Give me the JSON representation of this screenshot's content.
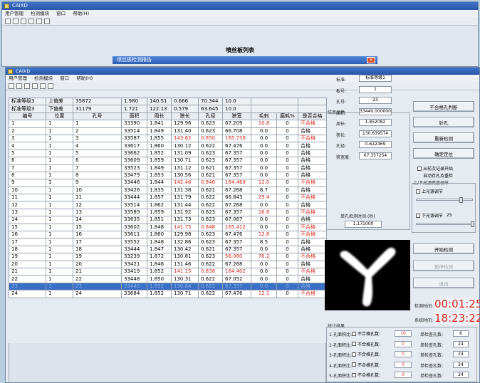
{
  "bg_window": {
    "title": "CAIXD",
    "menu": [
      "用户管理",
      "检测模块",
      "窗口",
      "帮助(H)"
    ],
    "heading": "喷丝板列表"
  },
  "modal": {
    "title": "喷丝板检测报告",
    "close": "×"
  },
  "main_window": {
    "title": "CAIXD",
    "menu": [
      "用户管理",
      "检测模块",
      "窗口",
      "帮助(H)"
    ]
  },
  "table": {
    "std_rows": [
      [
        "标准等级3",
        "上偏差",
        "35872",
        "1.980",
        "140.51",
        "0.666",
        "70.344",
        "10.0",
        "",
        ""
      ],
      [
        "标准等级3",
        "下偏差",
        "31179",
        "1.721",
        "122.13",
        "0.579",
        "63.645",
        "10.0",
        "",
        ""
      ]
    ],
    "headers": [
      "编号",
      "位置",
      "孔号",
      "面积",
      "周长",
      "狭长",
      "孔径",
      "狭宽",
      "毛刺",
      "磨耗%",
      "是否合格"
    ],
    "rows": [
      [
        "1",
        "1",
        "1",
        "33390",
        "1.841",
        "129.96",
        "0.623",
        "67.209",
        "10.8",
        "0",
        "不合格"
      ],
      [
        "2",
        "1",
        "2",
        "33514",
        "1.849",
        "131.40",
        "0.623",
        "66.708",
        "0.0",
        "0",
        "合格"
      ],
      [
        "3",
        "1",
        "3",
        "33587",
        "1.855",
        "143.62",
        "0.850",
        "165.738",
        "0.0",
        "0",
        "不合格"
      ],
      [
        "4",
        "1",
        "4",
        "33617",
        "1.860",
        "130.12",
        "0.622",
        "67.476",
        "0.0",
        "0",
        "合格"
      ],
      [
        "5",
        "1",
        "5",
        "33662",
        "1.852",
        "131.09",
        "0.623",
        "67.357",
        "0.0",
        "0",
        "合格"
      ],
      [
        "6",
        "1",
        "6",
        "33609",
        "1.859",
        "130.71",
        "0.623",
        "67.357",
        "0.0",
        "0",
        "合格"
      ],
      [
        "7",
        "1",
        "7",
        "33523",
        "1.849",
        "131.12",
        "0.621",
        "67.357",
        "0.0",
        "0",
        "合格"
      ],
      [
        "8",
        "1",
        "8",
        "33479",
        "1.853",
        "130.56",
        "0.621",
        "67.357",
        "0.0",
        "0",
        "合格"
      ],
      [
        "9",
        "1",
        "9",
        "33448",
        "1.844",
        "142.46",
        "0.846",
        "164.469",
        "12.0",
        "0",
        "不合格"
      ],
      [
        "10",
        "1",
        "10",
        "33426",
        "1.835",
        "131.38",
        "0.621",
        "67.268",
        "8.7",
        "0",
        "合格"
      ],
      [
        "11",
        "1",
        "11",
        "33444",
        "1.857",
        "131.79",
        "0.622",
        "66.843",
        "29.4",
        "0",
        "不合格"
      ],
      [
        "12",
        "1",
        "12",
        "33514",
        "1.862",
        "131.44",
        "0.622",
        "67.268",
        "0.0",
        "0",
        "合格"
      ],
      [
        "13",
        "1",
        "13",
        "33589",
        "1.859",
        "131.92",
        "0.623",
        "67.357",
        "16.8",
        "0",
        "不合格"
      ],
      [
        "14",
        "1",
        "14",
        "33635",
        "1.851",
        "131.73",
        "0.623",
        "67.067",
        "0.0",
        "0",
        "合格"
      ],
      [
        "15",
        "1",
        "15",
        "33602",
        "1.848",
        "141.75",
        "0.848",
        "165.412",
        "0.0",
        "0",
        "不合格"
      ],
      [
        "16",
        "1",
        "16",
        "33611",
        "1.860",
        "129.98",
        "0.623",
        "67.476",
        "12.8",
        "0",
        "不合格"
      ],
      [
        "17",
        "1",
        "17",
        "33552",
        "1.848",
        "132.86",
        "0.623",
        "67.357",
        "8.5",
        "0",
        "合格"
      ],
      [
        "18",
        "1",
        "18",
        "33444",
        "1.847",
        "130.42",
        "0.621",
        "67.357",
        "0.0",
        "0",
        "合格"
      ],
      [
        "19",
        "1",
        "19",
        "33239",
        "1.872",
        "130.81",
        "0.623",
        "56.080",
        "76.2",
        "0",
        "不合格"
      ],
      [
        "20",
        "1",
        "20",
        "33421",
        "1.846",
        "131.46",
        "0.622",
        "67.268",
        "0.0",
        "0",
        "合格"
      ],
      [
        "21",
        "1",
        "21",
        "33419",
        "1.852",
        "141.15",
        "0.838",
        "164.402",
        "0.0",
        "0",
        "不合格"
      ],
      [
        "22",
        "1",
        "22",
        "33448",
        "1.850",
        "130.31",
        "0.622",
        "67.052",
        "0.0",
        "0",
        "合格"
      ],
      [
        "23",
        "1",
        "23",
        "33440",
        "1.852",
        "130.64",
        "0.621",
        "67.357",
        "0.0",
        "0",
        "合格"
      ],
      [
        "24",
        "1",
        "24",
        "33684",
        "1.852",
        "130.71",
        "0.622",
        "67.476",
        "12.1",
        "0",
        "不合格"
      ]
    ],
    "selected_row": 22,
    "red_cells": {
      "0": [
        8,
        10
      ],
      "2": [
        5,
        6,
        7,
        10
      ],
      "8": [
        5,
        6,
        7,
        8,
        10
      ],
      "10": [
        8,
        10
      ],
      "12": [
        8,
        10
      ],
      "14": [
        5,
        6,
        7,
        10
      ],
      "15": [
        8,
        10
      ],
      "18": [
        7,
        8,
        10
      ],
      "20": [
        5,
        6,
        7,
        10
      ],
      "23": [
        8,
        10
      ]
    }
  },
  "results": {
    "section": "结果显示",
    "fields": [
      {
        "label": "标准:",
        "value": "标准等级1"
      },
      {
        "label": "板号:",
        "value": "1"
      },
      {
        "label": "孔号:",
        "value": "23"
      },
      {
        "label": "面积:",
        "value": "33440.000000"
      },
      {
        "label": "周长:",
        "value": "1.852082"
      },
      {
        "label": "狭长:",
        "value": "130.639574"
      },
      {
        "label": "孔径:",
        "value": "0.622469"
      },
      {
        "label": "狭宽度:",
        "value": "67.357254"
      }
    ],
    "single_time_label": "单孔检测时间:(秒)",
    "single_time_value": "1.171000"
  },
  "buttons": {
    "unqualified": "不合格孔判断",
    "hole": "针孔",
    "recheck": "重新检测",
    "position": "确定定位",
    "start": "开始检测",
    "pause": "暂停检测",
    "stop": "退出"
  },
  "options": {
    "from_last": "从前次记录开始",
    "auto_save": "自动存孔及重检",
    "light_group": "上/下光源亮度调节",
    "upper_light": "上光源调节",
    "lower_light": "下光源调节",
    "lower_value": "25"
  },
  "timers": {
    "detect_label": "检测时间:",
    "detect_value": "00:01:25",
    "system_label": "系统时间:",
    "system_value": "18:23:22"
  },
  "stats": {
    "section": "统计结果",
    "rows": [
      {
        "label": "1-孔面积比:",
        "chk": "不合格孔数:",
        "count": "10",
        "single_label": "单检查孔数:",
        "single": "6"
      },
      {
        "label": "2-孔面积比:",
        "chk": "不合格孔数:",
        "count": "0",
        "single_label": "单检查孔数:",
        "single": "24"
      },
      {
        "label": "3-孔面积比:",
        "chk": "不合格孔数:",
        "count": "0",
        "single_label": "单检查孔数:",
        "single": "24"
      },
      {
        "label": "4-孔面积比:",
        "chk": "不合格孔数:",
        "count": "0",
        "single_label": "单检查孔数:",
        "single": "24"
      },
      {
        "label": "5-孔面积比:",
        "chk": "不合格孔数:",
        "count": "0",
        "single_label": "单检查孔数:",
        "single": "24"
      }
    ]
  },
  "colors": {
    "accent": "#2a57a8",
    "error": "#d42a1f",
    "selection": "#3a6fc6"
  }
}
